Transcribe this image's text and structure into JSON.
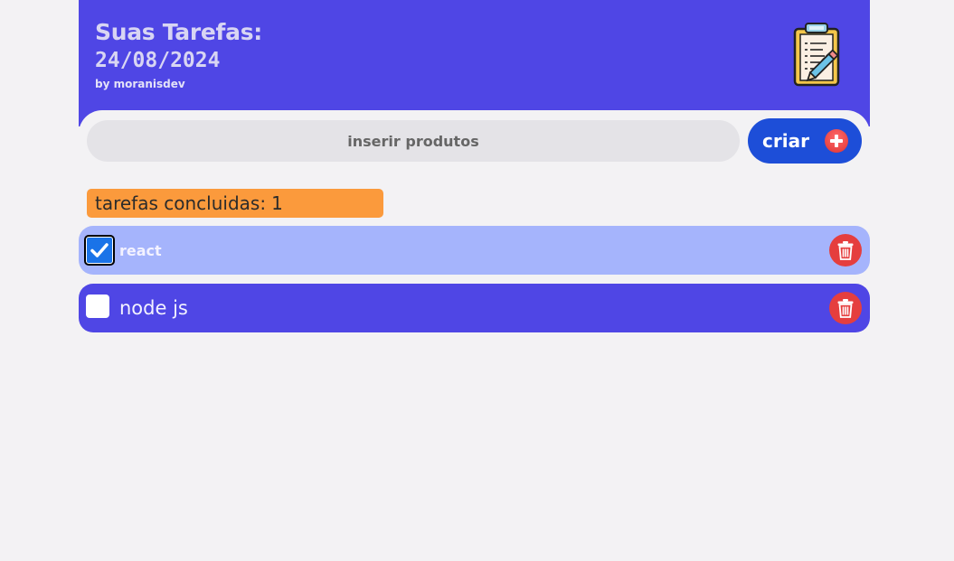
{
  "header": {
    "title": "Suas Tarefas:",
    "date": "24/08/2024",
    "author": "by moranisdev",
    "logo_icon": "clipboard-pencil-icon"
  },
  "form": {
    "placeholder": "inserir produtos",
    "create_label": "criar",
    "create_icon": "plus-circle-icon"
  },
  "counter": {
    "label": "tarefas concluidas:",
    "count": "1"
  },
  "tasks": [
    {
      "label": "react",
      "checked": true
    },
    {
      "label": "node js",
      "checked": false
    }
  ],
  "colors": {
    "primary": "#4f46e5",
    "done_row": "#a5b4fc",
    "create_button": "#1d4ed8",
    "counter_bg": "#fb9a3c",
    "delete": "#e53e3e"
  }
}
